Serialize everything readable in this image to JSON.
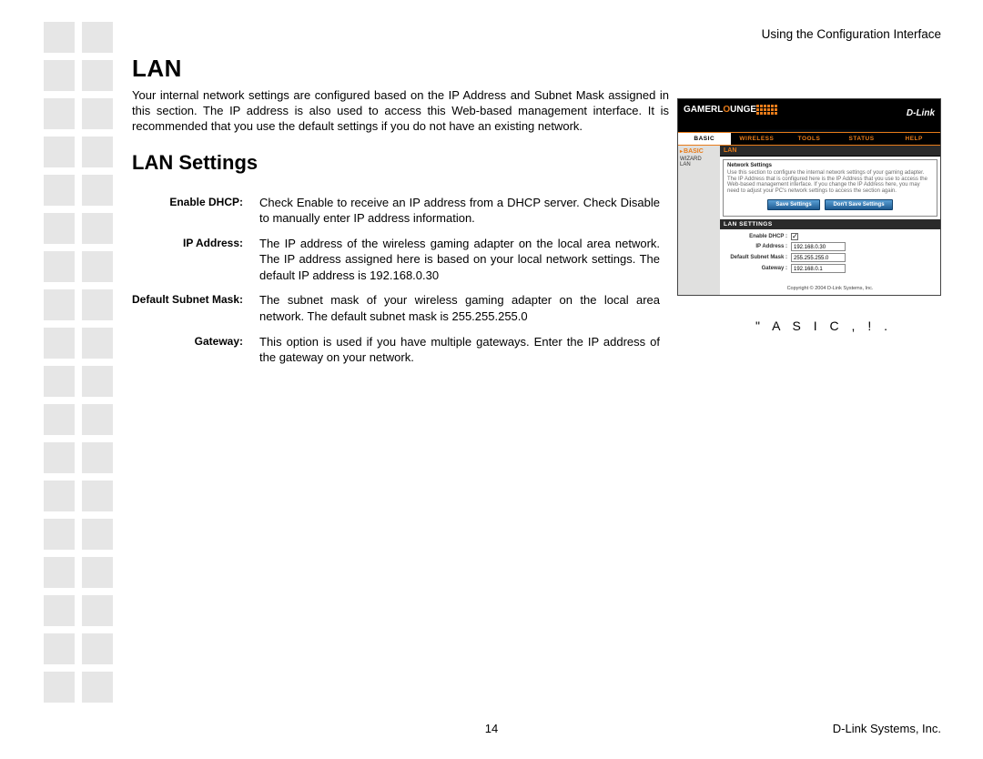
{
  "header": {
    "right": "Using the Configuration Interface"
  },
  "page": {
    "title": "LAN",
    "intro": "Your internal network settings are configured based on the IP Address and Subnet Mask assigned in this section. The IP address is also used to access this Web-based management interface. It is recommended that you use the default settings if you do not have an existing network.",
    "section_title": "LAN Settings"
  },
  "settings": [
    {
      "label": "Enable DHCP:",
      "desc": "Check Enable to receive an IP address from a DHCP server. Check Disable to manually enter IP address information."
    },
    {
      "label": "IP  Address:",
      "desc": "The IP address of the wireless gaming adapter on the local area network. The IP address assigned here is based on your local network settings. The default IP address is 192.168.0.30"
    },
    {
      "label": "Default Subnet Mask:",
      "desc": "The subnet mask of your wireless gaming adapter on the local area network. The default subnet mask is 255.255.255.0"
    },
    {
      "label": "Gateway:",
      "desc": "This option is used if you have multiple gateways. Enter the IP address of the gateway on your network."
    }
  ],
  "screenshot": {
    "brand_left": "GAMERL UNGE",
    "brand_accent": "O",
    "brand_right": "D-Link",
    "tabs": [
      "BASIC",
      "WIRELESS",
      "TOOLS",
      "STATUS",
      "HELP"
    ],
    "active_tab": 0,
    "sidebar": {
      "heading": "BASIC",
      "items": [
        "WIZARD",
        "LAN"
      ]
    },
    "section_lan": "LAN",
    "network_settings": {
      "title": "Network Settings",
      "text": "Use this section to configure the internal network settings of your gaming adapter. The IP Address that is configured here is the IP Address that you use to access the Web-based management interface. If you change the IP Address here, you may need to adjust your PC's network settings to access the section again."
    },
    "buttons": {
      "save": "Save Settings",
      "cancel": "Don't Save Settings"
    },
    "lan_bar": "LAN SETTINGS",
    "fields": {
      "enable_dhcp": {
        "label": "Enable DHCP :",
        "checked": true
      },
      "ip": {
        "label": "IP Address :",
        "value": "192.168.0.30"
      },
      "mask": {
        "label": "Default Subnet Mask :",
        "value": "255.255.255.0"
      },
      "gateway": {
        "label": "Gateway :",
        "value": "192.168.0.1"
      }
    },
    "copyright": "Copyright © 2004 D-Link Systems, Inc."
  },
  "caption": "\" A S I C     , ! .",
  "footer": {
    "page": "14",
    "right": "D-Link Systems, Inc."
  }
}
